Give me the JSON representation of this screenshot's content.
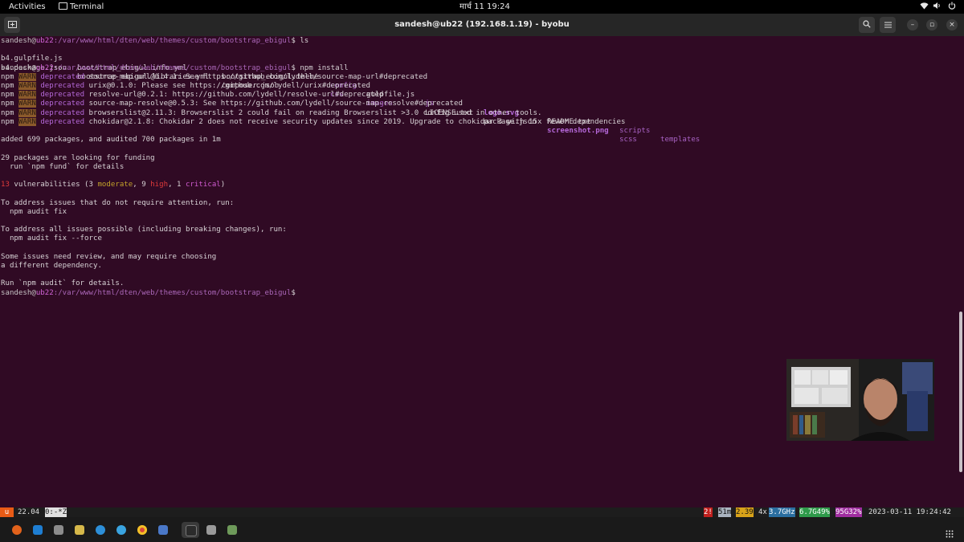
{
  "topbar": {
    "activities": "Activities",
    "app": "Terminal",
    "clock": "मार्च 11  19:24"
  },
  "titlebar": {
    "title": "sandesh@ub22 (192.168.1.19) - byobu"
  },
  "prompt": {
    "user": "sandesh",
    "at": "@",
    "host": "ub22",
    "path": ":/var/www/html/dten/web/themes/custom/bootstrap_ebigul",
    "sign": "$"
  },
  "commands": {
    "ls": " ls",
    "npm": " npm install"
  },
  "ls_row1": [
    "b4.gulpfile.js",
    "bootstrap_ebigul.info.yml",
    "bootstrap_ebigul.theme",
    "config",
    "gulpfile.js",
    "js",
    "logo.svg",
    "README.txt",
    "scripts",
    "templates"
  ],
  "ls_row2": [
    "b4.package.json",
    "bootstrap_ebigul.libraries.yml",
    "composer.json",
    "css",
    "images",
    "LICENSE.txt",
    "package.json",
    "screenshot.png",
    "scss"
  ],
  "warn_prefix": {
    "npm": "npm",
    "warn": "WARN",
    "deprecated": "deprecated"
  },
  "warnings": [
    "source-map-url@0.4.1: See https://github.com/lydell/source-map-url#deprecated",
    "urix@0.1.0: Please see https://github.com/lydell/urix#deprecated",
    "resolve-url@0.2.1: https://github.com/lydell/resolve-url#deprecated",
    "source-map-resolve@0.5.3: See https://github.com/lydell/source-map-resolve#deprecated",
    "browserslist@2.11.3: Browserslist 2 could fail on reading Browserslist >3.0 config used in other tools.",
    "chokidar@2.1.8: Chokidar 2 does not receive security updates since 2019. Upgrade to chokidar 3 with 15x fewer dependencies"
  ],
  "output": {
    "added": "added 699 packages, and audited 700 packages in 1m",
    "funding1": "29 packages are looking for funding",
    "funding2": "  run `npm fund` for details",
    "vuln_count": "13",
    "vuln_a": " vulnerabilities (3 ",
    "vuln_moderate": "moderate",
    "vuln_b": ", 9 ",
    "vuln_high": "high",
    "vuln_c": ", 1 ",
    "vuln_critical": "critical",
    "vuln_d": ")",
    "fix1": "To address issues that do not require attention, run:",
    "fix1_cmd": "  npm audit fix",
    "fix2": "To address all issues possible (including breaking changes), run:",
    "fix2_cmd": "  npm audit fix --force",
    "review1": "Some issues need review, and may require choosing",
    "review2": "a different dependency.",
    "run_audit": "Run `npm audit` for details."
  },
  "statusbar": {
    "u": "u",
    "ver": "22.04",
    "win": "0:-*Z",
    "updates": "2!",
    "uptime": "51m",
    "load": "2.39",
    "cpu_count": "4x",
    "freq": "3.7GHz",
    "mem": "6.7G49%",
    "disk": "95G32%",
    "datetime": "2023-03-11 19:24:42"
  },
  "colors": {
    "terminal_bg": "#300a24",
    "prompt_host": "#d163d7",
    "warn_bg": "#8b5a2b",
    "high": "#e03a3a"
  },
  "dock_icons": [
    "firefox-icon",
    "vscode-icon",
    "files-icon",
    "app-icon",
    "help-icon",
    "telegram-icon",
    "chrome-icon",
    "chat-icon",
    "terminal-icon",
    "trash-icon",
    "recycle-icon",
    "apps-grid-icon"
  ]
}
